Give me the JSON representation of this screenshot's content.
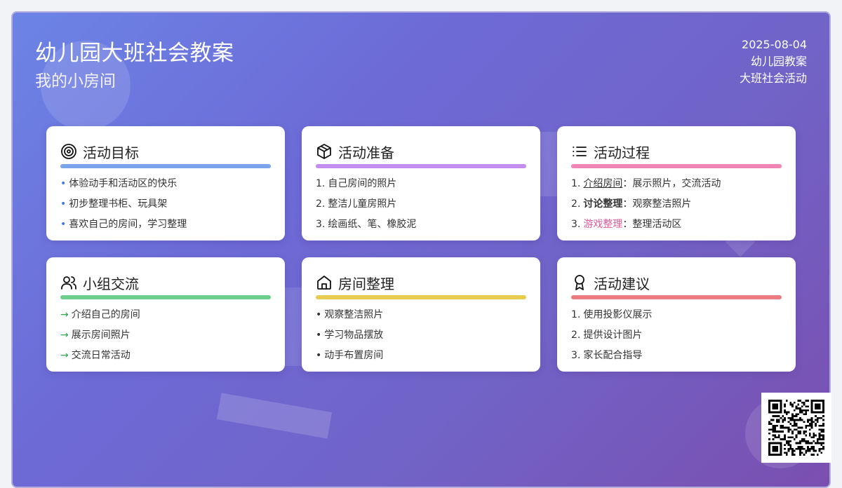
{
  "header": {
    "title": "幼儿园大班社会教案",
    "subtitle": "我的小房间",
    "date": "2025-08-04",
    "meta1": "幼儿园教案",
    "meta2": "大班社会活动"
  },
  "cards": [
    {
      "title": "活动目标",
      "icon": "target-icon",
      "accent": "#7ba4ec",
      "items": [
        {
          "mark": "•",
          "text": "体验动手和活动区的快乐"
        },
        {
          "mark": "•",
          "text": "初步整理书柜、玩具架"
        },
        {
          "mark": "•",
          "text": "喜欢自己的房间，学习整理"
        }
      ]
    },
    {
      "title": "活动准备",
      "icon": "box-icon",
      "accent": "#c38ef0",
      "items": [
        {
          "mark": "1.",
          "text": "自己房间的照片"
        },
        {
          "mark": "2.",
          "text": "整洁儿童房照片"
        },
        {
          "mark": "3.",
          "text": "绘画纸、笔、橡胶泥"
        }
      ]
    },
    {
      "title": "活动过程",
      "icon": "list-icon",
      "accent": "#f084b4",
      "items": [
        {
          "mark": "1.",
          "key": "介绍房间",
          "rest": "：展示照片，交流活动"
        },
        {
          "mark": "2.",
          "key": "讨论整理",
          "rest": "：观察整洁照片"
        },
        {
          "mark": "3.",
          "key": "游戏整理",
          "rest": "：整理活动区"
        }
      ]
    },
    {
      "title": "小组交流",
      "icon": "users-icon",
      "accent": "#6dcf8d",
      "items": [
        {
          "mark": "→",
          "text": "介绍自己的房间"
        },
        {
          "mark": "→",
          "text": "展示房间照片"
        },
        {
          "mark": "→",
          "text": "交流日常活动"
        }
      ]
    },
    {
      "title": "房间整理",
      "icon": "home-icon",
      "accent": "#ebca52",
      "items": [
        {
          "mark": "•",
          "text": "观察整洁照片"
        },
        {
          "mark": "•",
          "text": "学习物品摆放"
        },
        {
          "mark": "•",
          "text": "动手布置房间"
        }
      ]
    },
    {
      "title": "活动建议",
      "icon": "award-icon",
      "accent": "#ec7b82",
      "items": [
        {
          "mark": "1.",
          "text": "使用投影仪展示"
        },
        {
          "mark": "2.",
          "text": "提供设计图片"
        },
        {
          "mark": "3.",
          "text": "家长配合指导"
        }
      ]
    }
  ],
  "colors": {
    "goal_bullet": "#3f7be0",
    "arrow": "#2aa84a",
    "pink_text": "#e05a9a"
  },
  "qr": {
    "icon": "qr-code-icon"
  }
}
